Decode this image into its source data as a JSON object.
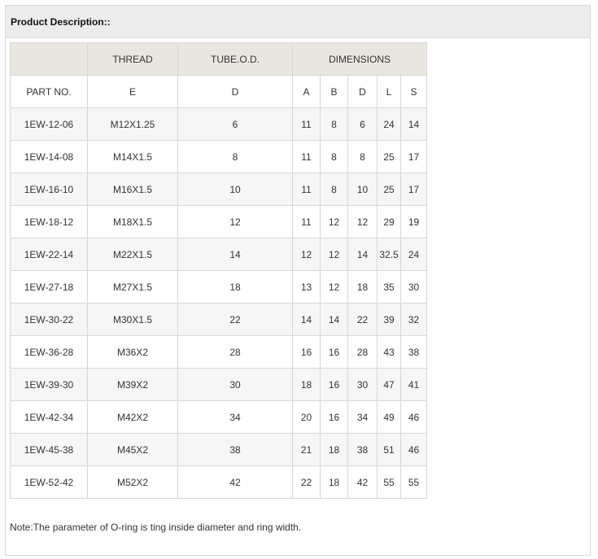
{
  "section": {
    "title": "Product Description::"
  },
  "table": {
    "header1": {
      "thread": "THREAD",
      "tube": "TUBE.O.D.",
      "dimensions": "DIMENSIONS"
    },
    "header2": {
      "part_no": "PART NO.",
      "e": "E",
      "d": "D",
      "a": "A",
      "b": "B",
      "d2": "D",
      "l": "L",
      "s": "S"
    },
    "rows": [
      [
        "1EW-12-06",
        "M12X1.25",
        "6",
        "11",
        "8",
        "6",
        "24",
        "14"
      ],
      [
        "1EW-14-08",
        "M14X1.5",
        "8",
        "11",
        "8",
        "8",
        "25",
        "17"
      ],
      [
        "1EW-16-10",
        "M16X1.5",
        "10",
        "11",
        "8",
        "10",
        "25",
        "17"
      ],
      [
        "1EW-18-12",
        "M18X1.5",
        "12",
        "11",
        "12",
        "12",
        "29",
        "19"
      ],
      [
        "1EW-22-14",
        "M22X1.5",
        "14",
        "12",
        "12",
        "14",
        "32.5",
        "24"
      ],
      [
        "1EW-27-18",
        "M27X1.5",
        "18",
        "13",
        "12",
        "18",
        "35",
        "30"
      ],
      [
        "1EW-30-22",
        "M30X1.5",
        "22",
        "14",
        "14",
        "22",
        "39",
        "32"
      ],
      [
        "1EW-36-28",
        "M36X2",
        "28",
        "16",
        "16",
        "28",
        "43",
        "38"
      ],
      [
        "1EW-39-30",
        "M39X2",
        "30",
        "18",
        "16",
        "30",
        "47",
        "41"
      ],
      [
        "1EW-42-34",
        "M42X2",
        "34",
        "20",
        "16",
        "34",
        "49",
        "46"
      ],
      [
        "1EW-45-38",
        "M45X2",
        "38",
        "21",
        "18",
        "38",
        "51",
        "46"
      ],
      [
        "1EW-52-42",
        "M52X2",
        "42",
        "22",
        "18",
        "42",
        "55",
        "55"
      ]
    ]
  },
  "note": "Note:The parameter of O-ring is ting inside diameter and ring width."
}
